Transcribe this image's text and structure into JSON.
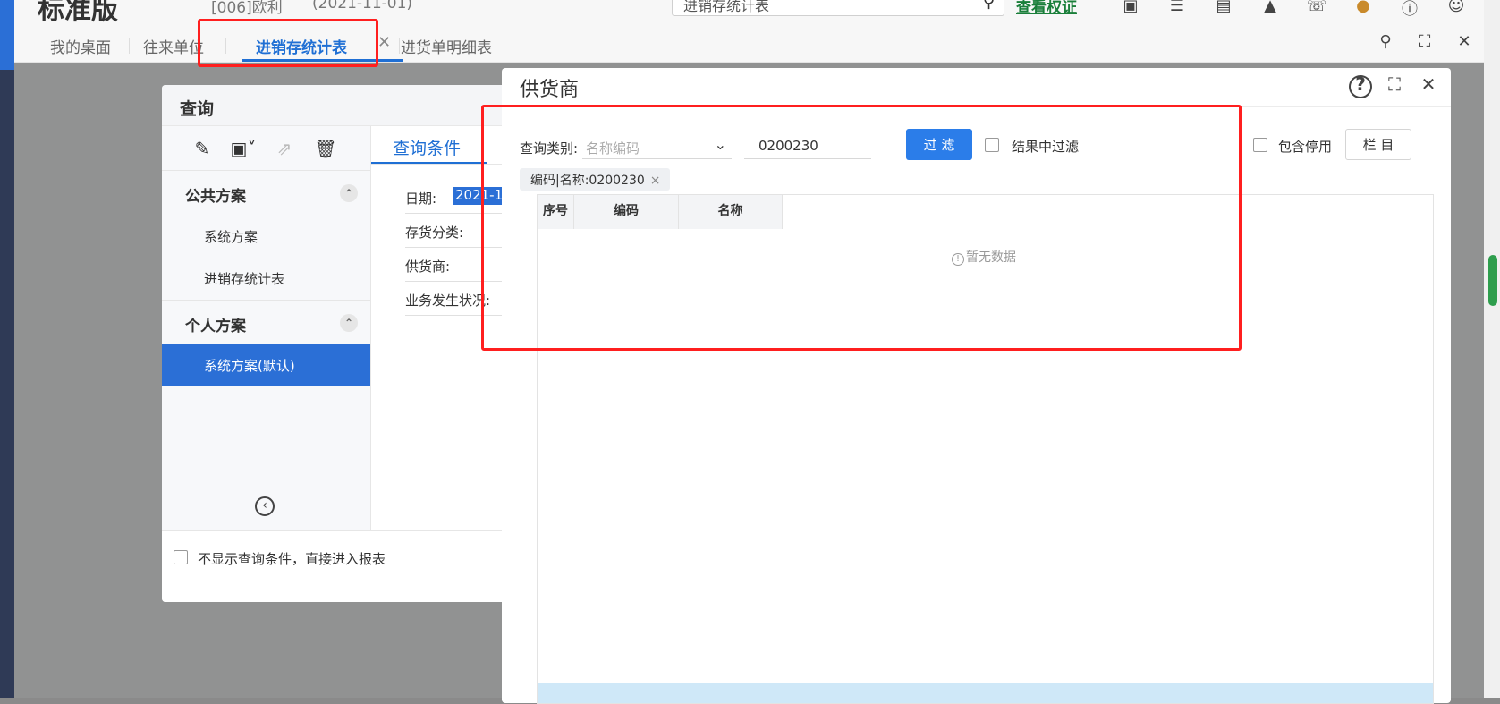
{
  "header": {
    "logo_text": "标准版",
    "company": "[006]欧利",
    "date": "(2021-11-01)",
    "search_value": "进销存统计表",
    "link_label": "查看权证"
  },
  "tabs": [
    {
      "label": "我的桌面"
    },
    {
      "label": "往来单位"
    },
    {
      "label": "进销存统计表"
    },
    {
      "label": "进货单明细表"
    }
  ],
  "query": {
    "title": "查询",
    "groups": {
      "public": {
        "title": "公共方案",
        "items": [
          "系统方案",
          "进销存统计表"
        ]
      },
      "personal": {
        "title": "个人方案",
        "items": [
          "系统方案(默认)"
        ]
      }
    },
    "tab_label": "查询条件",
    "fields": [
      "日期:",
      "存货分类:",
      "供货商:",
      "业务发生状况:"
    ],
    "date_value": "2021-1",
    "footer_checkbox_label": "不显示查询条件，直接进入报表"
  },
  "dialog": {
    "title": "供货商",
    "filter": {
      "category_label": "查询类别:",
      "category_placeholder": "名称编码",
      "keyword_value": "0200230",
      "filter_button": "过 滤",
      "result_filter_label": "结果中过滤",
      "include_disabled_label": "包含停用",
      "columns_button": "栏 目"
    },
    "chip": "编码|名称:0200230",
    "grid": {
      "columns": [
        "序号",
        "编码",
        "名称"
      ],
      "empty_text": "暂无数据"
    }
  },
  "colors": {
    "primary": "#2b6fd6",
    "annotation": "#ff1f1f",
    "scroll_thumb": "#2e9e4d"
  }
}
